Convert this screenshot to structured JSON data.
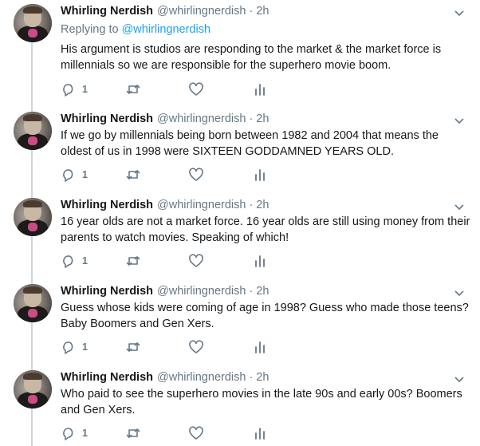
{
  "colors": {
    "text": "#14171a",
    "muted": "#657786",
    "link": "#1da1f2",
    "thread_line": "#ccd6dd"
  },
  "icons": {
    "reply": "reply-icon",
    "retweet": "retweet-icon",
    "like": "heart-icon",
    "analytics": "analytics-icon",
    "caret": "chevron-down-icon",
    "avatar": "avatar"
  },
  "tweets": [
    {
      "name": "Whirling Nerdish",
      "handle": "@whirlingnerdish",
      "separator": "·",
      "time": "2h",
      "replying_prefix": "Replying to",
      "replying_to": "@whirlingnerdish",
      "text_lines": [
        "His argument is studios are responding to the market & the market force is",
        "millennials so we are responsible for the superhero movie boom."
      ],
      "reply_count": "1"
    },
    {
      "name": "Whirling Nerdish",
      "handle": "@whirlingnerdish",
      "separator": "·",
      "time": "2h",
      "text_lines": [
        "If we go by millennials being born between 1982 and 2004 that means the",
        "oldest of us in 1998 were SIXTEEN GODDAMNED YEARS OLD."
      ],
      "reply_count": "1"
    },
    {
      "name": "Whirling Nerdish",
      "handle": "@whirlingnerdish",
      "separator": "·",
      "time": "2h",
      "text_lines": [
        "16 year olds are not a market force. 16 year olds are still using money from their",
        "parents to watch movies. Speaking of which!"
      ],
      "reply_count": "1"
    },
    {
      "name": "Whirling Nerdish",
      "handle": "@whirlingnerdish",
      "separator": "·",
      "time": "2h",
      "text_lines": [
        "Guess whose kids were coming of age in 1998? Guess who made those teens?",
        "Baby Boomers and Gen Xers."
      ],
      "reply_count": "1"
    },
    {
      "name": "Whirling Nerdish",
      "handle": "@whirlingnerdish",
      "separator": "·",
      "time": "2h",
      "text_lines": [
        "Who paid to see the superhero movies in the late 90s and early 00s? Boomers",
        "and Gen Xers."
      ],
      "reply_count": "1"
    }
  ]
}
